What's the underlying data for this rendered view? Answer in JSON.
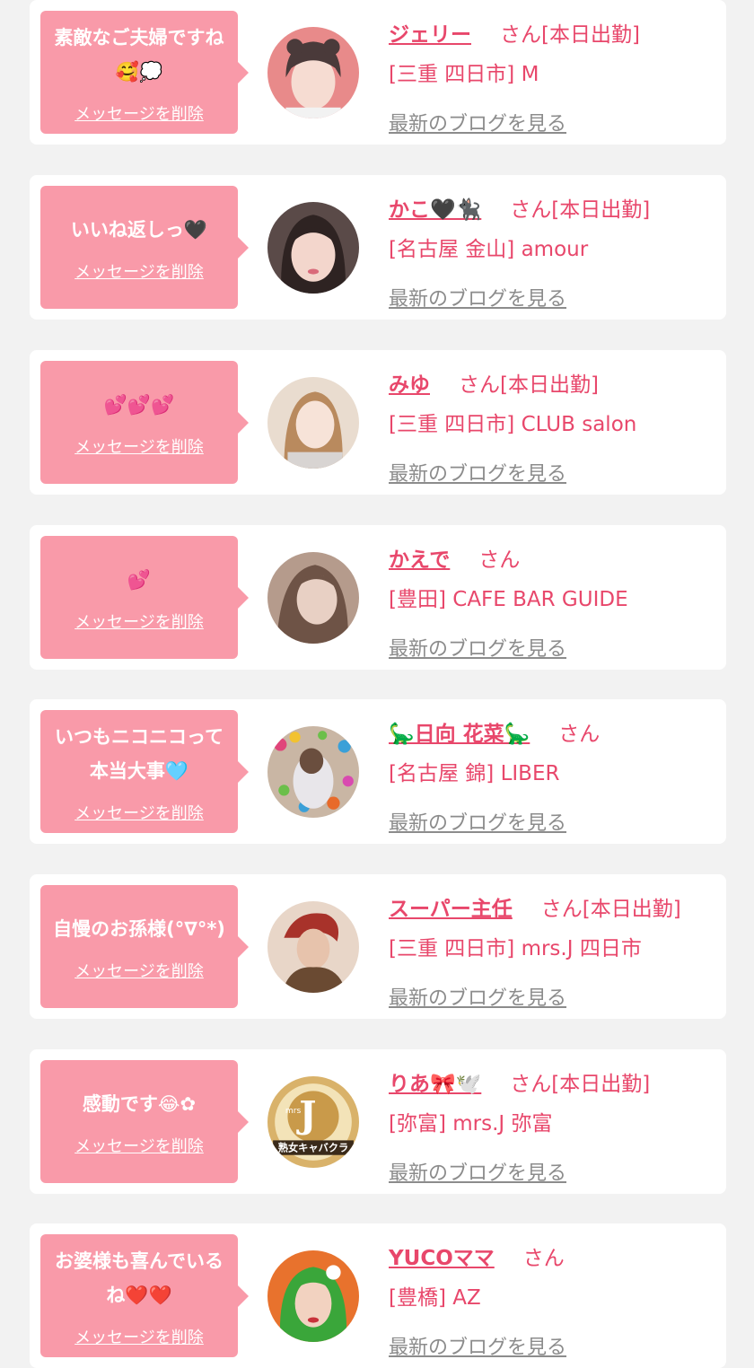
{
  "cards": [
    {
      "message": "素敵なご夫婦ですね🥰💭",
      "delete_label": "メッセージを削除",
      "name": "ジェリー",
      "suffix": "さん[本日出勤]",
      "shop": "[三重 四日市] M",
      "blog_label": "最新のブログを見る",
      "avatar_color": "#e88a8a"
    },
    {
      "message": "いいね返しっ🖤",
      "delete_label": "メッセージを削除",
      "name": "かこ🖤🐈‍⬛",
      "suffix": "さん[本日出勤]",
      "shop": "[名古屋 金山] amour",
      "blog_label": "最新のブログを見る",
      "avatar_color": "#5a4a48"
    },
    {
      "message": "💕💕💕",
      "delete_label": "メッセージを削除",
      "name": "みゆ",
      "suffix": "さん[本日出勤]",
      "shop": "[三重 四日市] CLUB salon",
      "blog_label": "最新のブログを見る",
      "avatar_color": "#e9dccf"
    },
    {
      "message": "💕",
      "delete_label": "メッセージを削除",
      "name": "かえで",
      "suffix": "さん",
      "shop": "[豊田] CAFE BAR GUIDE",
      "blog_label": "最新のブログを見る",
      "avatar_color": "#b59b8c"
    },
    {
      "message": "いつもニコニコって本当大事🩵",
      "delete_label": "メッセージを削除",
      "name": "🦕日向 花菜🦕",
      "suffix": "さん",
      "shop": "[名古屋 錦] LIBER",
      "blog_label": "最新のブログを見る",
      "avatar_color": "#c9b6a4"
    },
    {
      "message": "自慢のお孫様(°∇°*)",
      "delete_label": "メッセージを削除",
      "name": "スーパー主任",
      "suffix": "さん[本日出勤]",
      "shop": "[三重 四日市] mrs.J 四日市",
      "blog_label": "最新のブログを見る",
      "avatar_color": "#b36a4a"
    },
    {
      "message": "感動です😂✿",
      "delete_label": "メッセージを削除",
      "name": "りあ🎀🕊️",
      "suffix": "さん[本日出勤]",
      "shop": "[弥富] mrs.J 弥富",
      "blog_label": "最新のブログを見る",
      "avatar_color": "#d9b26a",
      "avatar_logo_text": "mrs.J",
      "avatar_logo_subtext": "熟女キャバクラ"
    },
    {
      "message": "お婆様も喜んでいるね❤️❤️",
      "delete_label": "メッセージを削除",
      "name": "YUCOママ",
      "suffix": "さん",
      "shop": "[豊橋] AZ",
      "blog_label": "最新のブログを見る",
      "avatar_color": "#e8722d"
    }
  ]
}
